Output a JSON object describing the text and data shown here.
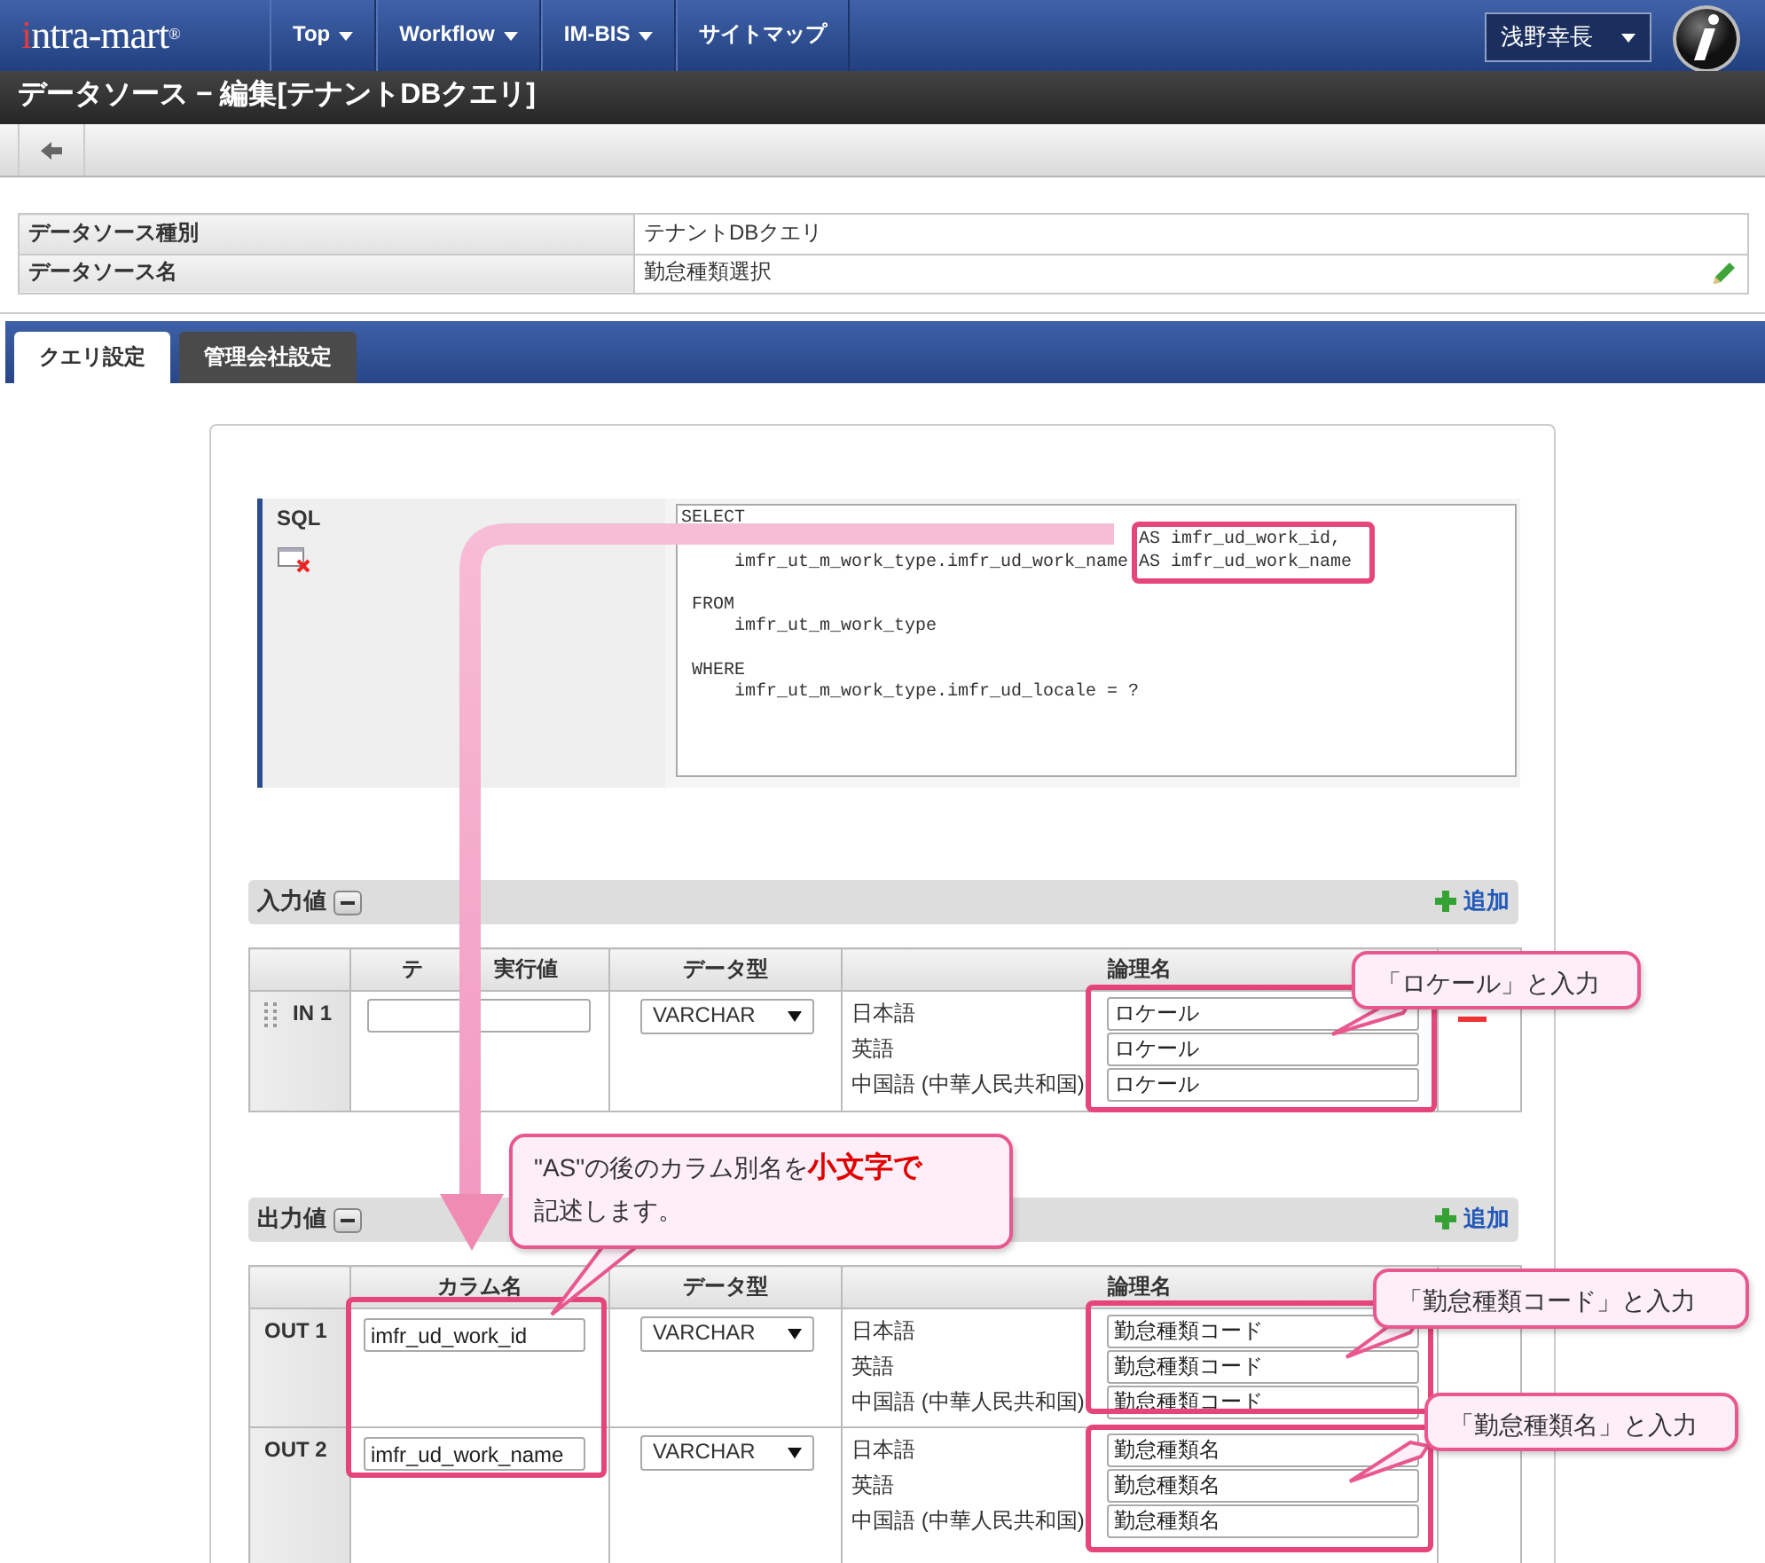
{
  "header": {
    "logo": "intra-mart",
    "logo_mark": "®",
    "user": "浅野幸長",
    "nav": [
      {
        "label": "Top",
        "dropdown": true
      },
      {
        "label": "Workflow",
        "dropdown": true
      },
      {
        "label": "IM-BIS",
        "dropdown": true
      },
      {
        "label": "サイトマップ",
        "dropdown": false
      }
    ]
  },
  "page_title": "データソース − 編集[テナントDBクエリ]",
  "properties": [
    {
      "label": "データソース種別",
      "value": "テナントDBクエリ",
      "editable": false
    },
    {
      "label": "データソース名",
      "value": "勤怠種類選択",
      "editable": true
    }
  ],
  "tabs": [
    {
      "label": "クエリ設定",
      "selected": true
    },
    {
      "label": "管理会社設定",
      "selected": false
    }
  ],
  "sql": {
    "label": "SQL",
    "lines": [
      {
        "kind": "code",
        "text": "SELECT"
      },
      {
        "kind": "covered",
        "text": "AS imfr_ud_work_id,"
      },
      {
        "kind": "code",
        "text": "     imfr_ut_m_work_type.imfr_ud_work_name AS imfr_ud_work_name"
      },
      {
        "kind": "blank"
      },
      {
        "kind": "code",
        "text": " FROM"
      },
      {
        "kind": "code",
        "text": "     imfr_ut_m_work_type"
      },
      {
        "kind": "blank"
      },
      {
        "kind": "code",
        "text": " WHERE"
      },
      {
        "kind": "code",
        "text": "     imfr_ut_m_work_type.imfr_ud_locale = ?"
      }
    ]
  },
  "inputs": {
    "title": "入力値",
    "add_label": "追加",
    "columns": [
      {
        "texts": [
          "テ",
          "実行値"
        ]
      },
      {
        "texts": [
          "データ型"
        ]
      },
      {
        "texts": [
          "論理名"
        ]
      }
    ],
    "rows": [
      {
        "id": "IN 1",
        "data_type": "VARCHAR",
        "deletable": true,
        "names": [
          {
            "lang": "日本語",
            "value": "ロケール"
          },
          {
            "lang": "英語",
            "value": "ロケール"
          },
          {
            "lang": "中国語 (中華人民共和国)",
            "value": "ロケール"
          }
        ]
      }
    ]
  },
  "outputs": {
    "title": "出力値",
    "add_label": "追加",
    "columns": [
      {
        "texts": [
          "カラム名"
        ]
      },
      {
        "texts": [
          "データ型"
        ]
      },
      {
        "texts": [
          "論理名"
        ]
      }
    ],
    "rows": [
      {
        "id": "OUT 1",
        "value": "imfr_ud_work_id",
        "data_type": "VARCHAR",
        "names": [
          {
            "lang": "日本語",
            "value": "勤怠種類コード"
          },
          {
            "lang": "英語",
            "value": "勤怠種類コード"
          },
          {
            "lang": "中国語 (中華人民共和国)",
            "value": "勤怠種類コード"
          }
        ]
      },
      {
        "id": "OUT 2",
        "value": "imfr_ud_work_name",
        "data_type": "VARCHAR",
        "names": [
          {
            "lang": "日本語",
            "value": "勤怠種類名"
          },
          {
            "lang": "英語",
            "value": "勤怠種類名"
          },
          {
            "lang": "中国語 (中華人民共和国)",
            "value": "勤怠種類名"
          }
        ]
      }
    ]
  },
  "callouts": [
    {
      "lines": [
        "「ロケール」と入力"
      ]
    },
    {
      "lines": [
        "\"AS\"の後のカラム別名を**小文字で**",
        "記述します。"
      ]
    },
    {
      "lines": [
        "「勤怠種類コード」と入力"
      ]
    },
    {
      "lines": [
        "「勤怠種類名」と入力"
      ]
    }
  ]
}
